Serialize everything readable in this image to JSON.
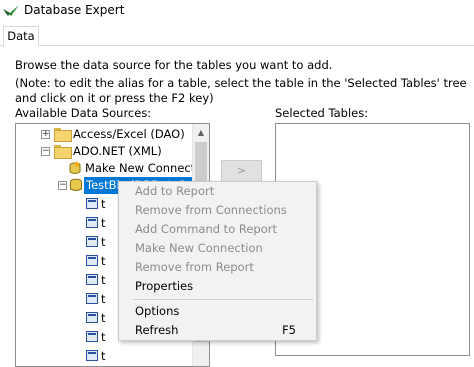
{
  "window": {
    "title": "Database Expert"
  },
  "tabs": [
    {
      "label": "Data"
    }
  ],
  "instructions": {
    "line1": "Browse the data source for the tables you want to add.",
    "line2": "(Note: to edit the alias for a table, select the table in the 'Selected Tables' tree and click on it or press the F2 key)"
  },
  "available": {
    "label": "Available Data Sources:",
    "tree": {
      "access": {
        "expander": "+",
        "label": "Access/Excel (DAO)"
      },
      "ado": {
        "expander": "−",
        "label": "ADO.NET (XML)"
      },
      "make_new": {
        "label": "Make New Connection"
      },
      "dataset": {
        "expander": "−",
        "label": "TestBindDBDataSet"
      },
      "tables": [
        "t",
        "t",
        "t",
        "t",
        "t",
        "t",
        "t",
        "t",
        "t",
        "t"
      ]
    }
  },
  "move_button": {
    "label": ">"
  },
  "selected": {
    "label": "Selected Tables:"
  },
  "context_menu": {
    "items": [
      {
        "label": "Add to Report",
        "enabled": false,
        "shortcut": ""
      },
      {
        "label": "Remove from Connections",
        "enabled": false,
        "shortcut": ""
      },
      {
        "label": "Add Command to Report",
        "enabled": false,
        "shortcut": ""
      },
      {
        "label": "Make New Connection",
        "enabled": false,
        "shortcut": ""
      },
      {
        "label": "Remove from Report",
        "enabled": false,
        "shortcut": ""
      },
      {
        "label": "Properties",
        "enabled": true,
        "shortcut": ""
      },
      {
        "label": "Options",
        "enabled": true,
        "shortcut": ""
      },
      {
        "label": "Refresh",
        "enabled": true,
        "shortcut": "F5"
      }
    ]
  },
  "colors": {
    "selection": "#0078d7",
    "menu_bg": "#f2f2f2",
    "disabled_text": "#8c8c8c"
  }
}
